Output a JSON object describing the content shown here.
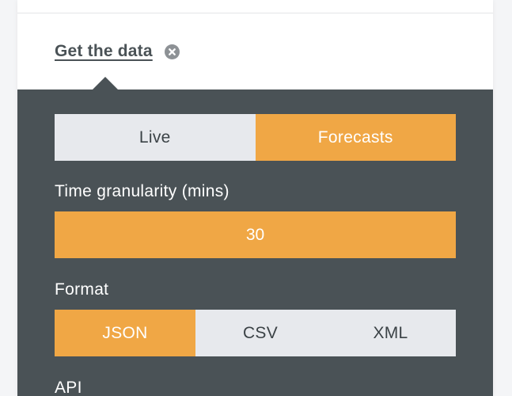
{
  "header": {
    "get_data_label": "Get the data"
  },
  "icons": {
    "close": "close-circle-icon"
  },
  "data_type": {
    "options": [
      {
        "label": "Live",
        "active": false
      },
      {
        "label": "Forecasts",
        "active": true
      }
    ]
  },
  "granularity": {
    "label": "Time granularity (mins)",
    "value": "30"
  },
  "format": {
    "label": "Format",
    "options": [
      {
        "label": "JSON",
        "active": true
      },
      {
        "label": "CSV",
        "active": false
      },
      {
        "label": "XML",
        "active": false
      }
    ]
  },
  "api": {
    "label": "API"
  },
  "colors": {
    "accent": "#f0a745",
    "panel": "#4a5256",
    "inactive": "#e7e9ed"
  }
}
